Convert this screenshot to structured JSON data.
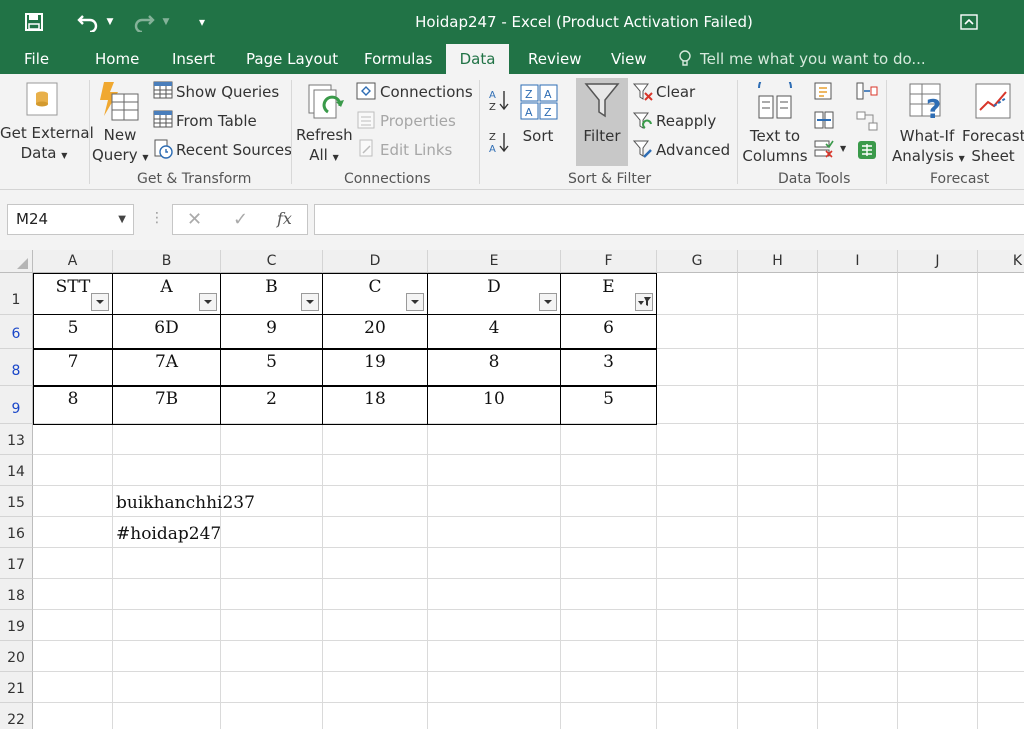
{
  "window": {
    "title": "Hoidap247 - Excel (Product Activation Failed)"
  },
  "icons": {
    "save": "save-icon",
    "undo": "undo-icon",
    "redo": "redo-icon",
    "customize": "customize-qat-icon",
    "ribbon_display": "ribbon-display-options-icon",
    "tell_me": "lightbulb-icon",
    "get_external": "database-icon",
    "new_query": "new-query-icon",
    "show_queries": "table-icon",
    "from_table": "table-icon",
    "recent_sources": "clock-icon",
    "refresh": "refresh-icon",
    "connections": "connections-icon",
    "properties": "properties-icon",
    "edit_links": "links-icon",
    "sort_az": "sort-a-z-icon",
    "sort_za": "sort-z-a-icon",
    "sort": "sort-icon",
    "filter": "funnel-icon",
    "clear": "clear-filter-icon",
    "reapply": "reapply-icon",
    "advanced": "advanced-filter-icon",
    "text_to_columns": "text-to-columns-icon",
    "what_if": "what-if-icon",
    "forecast_sheet": "forecast-chart-icon",
    "cancel": "cancel-x-icon",
    "enter": "check-icon",
    "fx": "function-icon",
    "filter_dropdown": "dropdown-arrow-icon",
    "filter_active": "funnel-filter-icon"
  },
  "colors": {
    "excel_green": "#217346",
    "ribbon_bg": "#f3f3f3",
    "row_number_filtered": "#1a47c9"
  },
  "tabs": [
    {
      "label": "File"
    },
    {
      "label": "Home"
    },
    {
      "label": "Insert"
    },
    {
      "label": "Page Layout"
    },
    {
      "label": "Formulas"
    },
    {
      "label": "Data",
      "active": true
    },
    {
      "label": "Review"
    },
    {
      "label": "View"
    }
  ],
  "tell_me": "Tell me what you want to do...",
  "ribbon": {
    "get_external": {
      "line1": "Get External",
      "line2": "Data"
    },
    "new_query": {
      "line1": "New",
      "line2": "Query"
    },
    "show_queries": "Show Queries",
    "from_table": "From Table",
    "recent_sources": "Recent Sources",
    "group_get_transform": "Get & Transform",
    "refresh": {
      "line1": "Refresh",
      "line2": "All"
    },
    "connections": "Connections",
    "properties": "Properties",
    "edit_links": "Edit Links",
    "group_connections": "Connections",
    "sort": "Sort",
    "filter": "Filter",
    "clear": "Clear",
    "reapply": "Reapply",
    "advanced": "Advanced",
    "group_sort_filter": "Sort & Filter",
    "text_to_columns": {
      "line1": "Text to",
      "line2": "Columns"
    },
    "group_data_tools": "Data Tools",
    "what_if": {
      "line1": "What-If",
      "line2": "Analysis"
    },
    "forecast_sheet": {
      "line1": "Forecast",
      "line2": "Sheet"
    },
    "group_forecast": "Forecast"
  },
  "formula_bar": {
    "name_box": "M24",
    "formula": ""
  },
  "sheet": {
    "columns": [
      "A",
      "B",
      "C",
      "D",
      "E",
      "F",
      "G",
      "H",
      "I",
      "J",
      "K"
    ],
    "rows": [
      "1",
      "6",
      "8",
      "9",
      "13",
      "14",
      "15",
      "16",
      "17",
      "18",
      "19",
      "20",
      "21",
      "22"
    ],
    "header": [
      "STT",
      "A",
      "B",
      "C",
      "D",
      "E"
    ],
    "data": [
      [
        "5",
        "6D",
        "9",
        "20",
        "4",
        "6"
      ],
      [
        "7",
        "7A",
        "5",
        "19",
        "8",
        "3"
      ],
      [
        "8",
        "7B",
        "2",
        "18",
        "10",
        "5"
      ]
    ],
    "b15": "buikhanchhi237",
    "b16": "#hoidap247"
  }
}
